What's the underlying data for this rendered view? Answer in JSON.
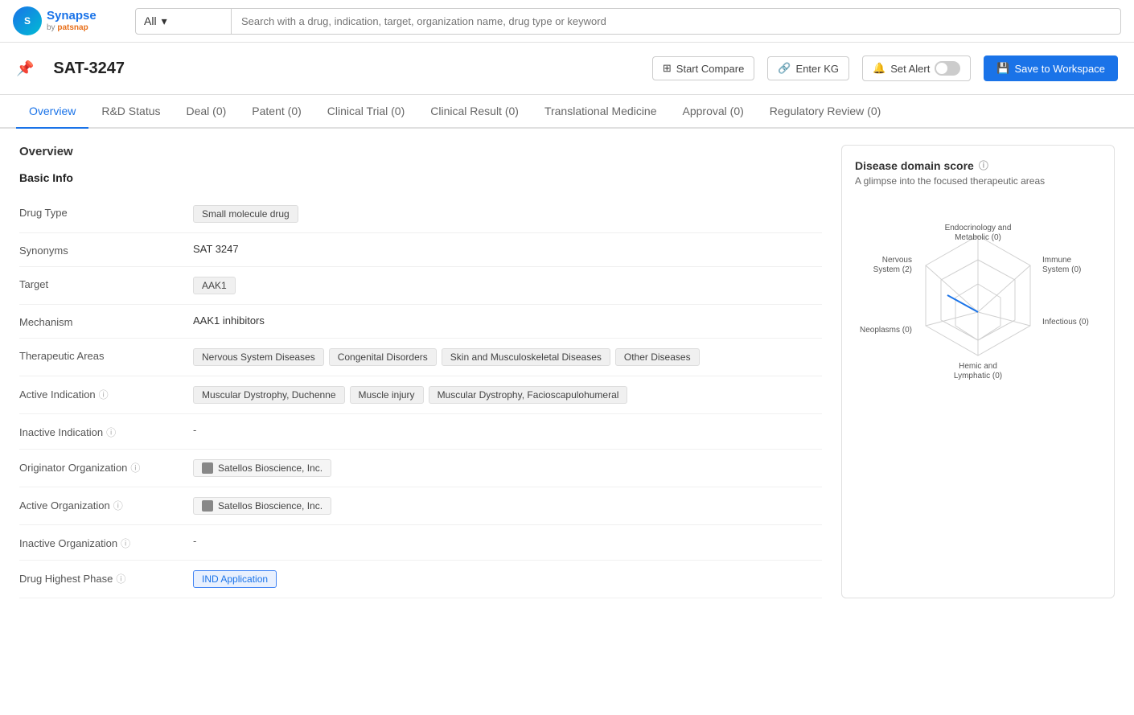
{
  "navbar": {
    "logo": {
      "name": "Synapse",
      "by": "by",
      "brand": "patsnap"
    },
    "search_dropdown": "All",
    "search_placeholder": "Search with a drug, indication, target, organization name, drug type or keyword"
  },
  "drug_header": {
    "name": "SAT-3247",
    "actions": {
      "start_compare": "Start Compare",
      "enter_kg": "Enter KG",
      "set_alert": "Set Alert",
      "save_workspace": "Save to Workspace"
    }
  },
  "tabs": [
    {
      "label": "Overview",
      "active": true
    },
    {
      "label": "R&D Status",
      "active": false
    },
    {
      "label": "Deal (0)",
      "active": false
    },
    {
      "label": "Patent (0)",
      "active": false
    },
    {
      "label": "Clinical Trial (0)",
      "active": false
    },
    {
      "label": "Clinical Result (0)",
      "active": false
    },
    {
      "label": "Translational Medicine",
      "active": false
    },
    {
      "label": "Approval (0)",
      "active": false
    },
    {
      "label": "Regulatory Review (0)",
      "active": false
    }
  ],
  "overview": {
    "section_title": "Overview",
    "basic_info_title": "Basic Info",
    "fields": {
      "drug_type": {
        "label": "Drug Type",
        "value": "Small molecule drug"
      },
      "synonyms": {
        "label": "Synonyms",
        "value": "SAT 3247"
      },
      "target": {
        "label": "Target",
        "value": "AAK1"
      },
      "mechanism": {
        "label": "Mechanism",
        "value": "AAK1 inhibitors"
      },
      "therapeutic_areas": {
        "label": "Therapeutic Areas",
        "tags": [
          "Nervous System Diseases",
          "Congenital Disorders",
          "Skin and Musculoskeletal Diseases",
          "Other Diseases"
        ]
      },
      "active_indication": {
        "label": "Active Indication",
        "tags": [
          "Muscular Dystrophy, Duchenne",
          "Muscle injury",
          "Muscular Dystrophy, Facioscapulohumeral"
        ]
      },
      "inactive_indication": {
        "label": "Inactive Indication",
        "value": "-"
      },
      "originator_org": {
        "label": "Originator Organization",
        "value": "Satellos Bioscience, Inc."
      },
      "active_org": {
        "label": "Active Organization",
        "value": "Satellos Bioscience, Inc."
      },
      "inactive_org": {
        "label": "Inactive Organization",
        "value": "-"
      },
      "highest_phase": {
        "label": "Drug Highest Phase",
        "value": "IND Application"
      }
    }
  },
  "disease_domain": {
    "title": "Disease domain score",
    "subtitle": "A glimpse into the focused therapeutic areas",
    "axes": [
      {
        "label": "Endocrinology and Metabolic (0)",
        "value": 0,
        "angle": 90
      },
      {
        "label": "Immune System (0)",
        "value": 0,
        "angle": 30
      },
      {
        "label": "Infectious (0)",
        "value": 0,
        "angle": 330
      },
      {
        "label": "Hemic and Lymphatic (0)",
        "value": 0,
        "angle": 270
      },
      {
        "label": "Neoplasms (0)",
        "value": 0,
        "angle": 210
      },
      {
        "label": "Nervous System (2)",
        "value": 2,
        "angle": 150
      }
    ],
    "colors": {
      "accent": "#1a73e8",
      "grid": "#c0c0c0"
    }
  }
}
